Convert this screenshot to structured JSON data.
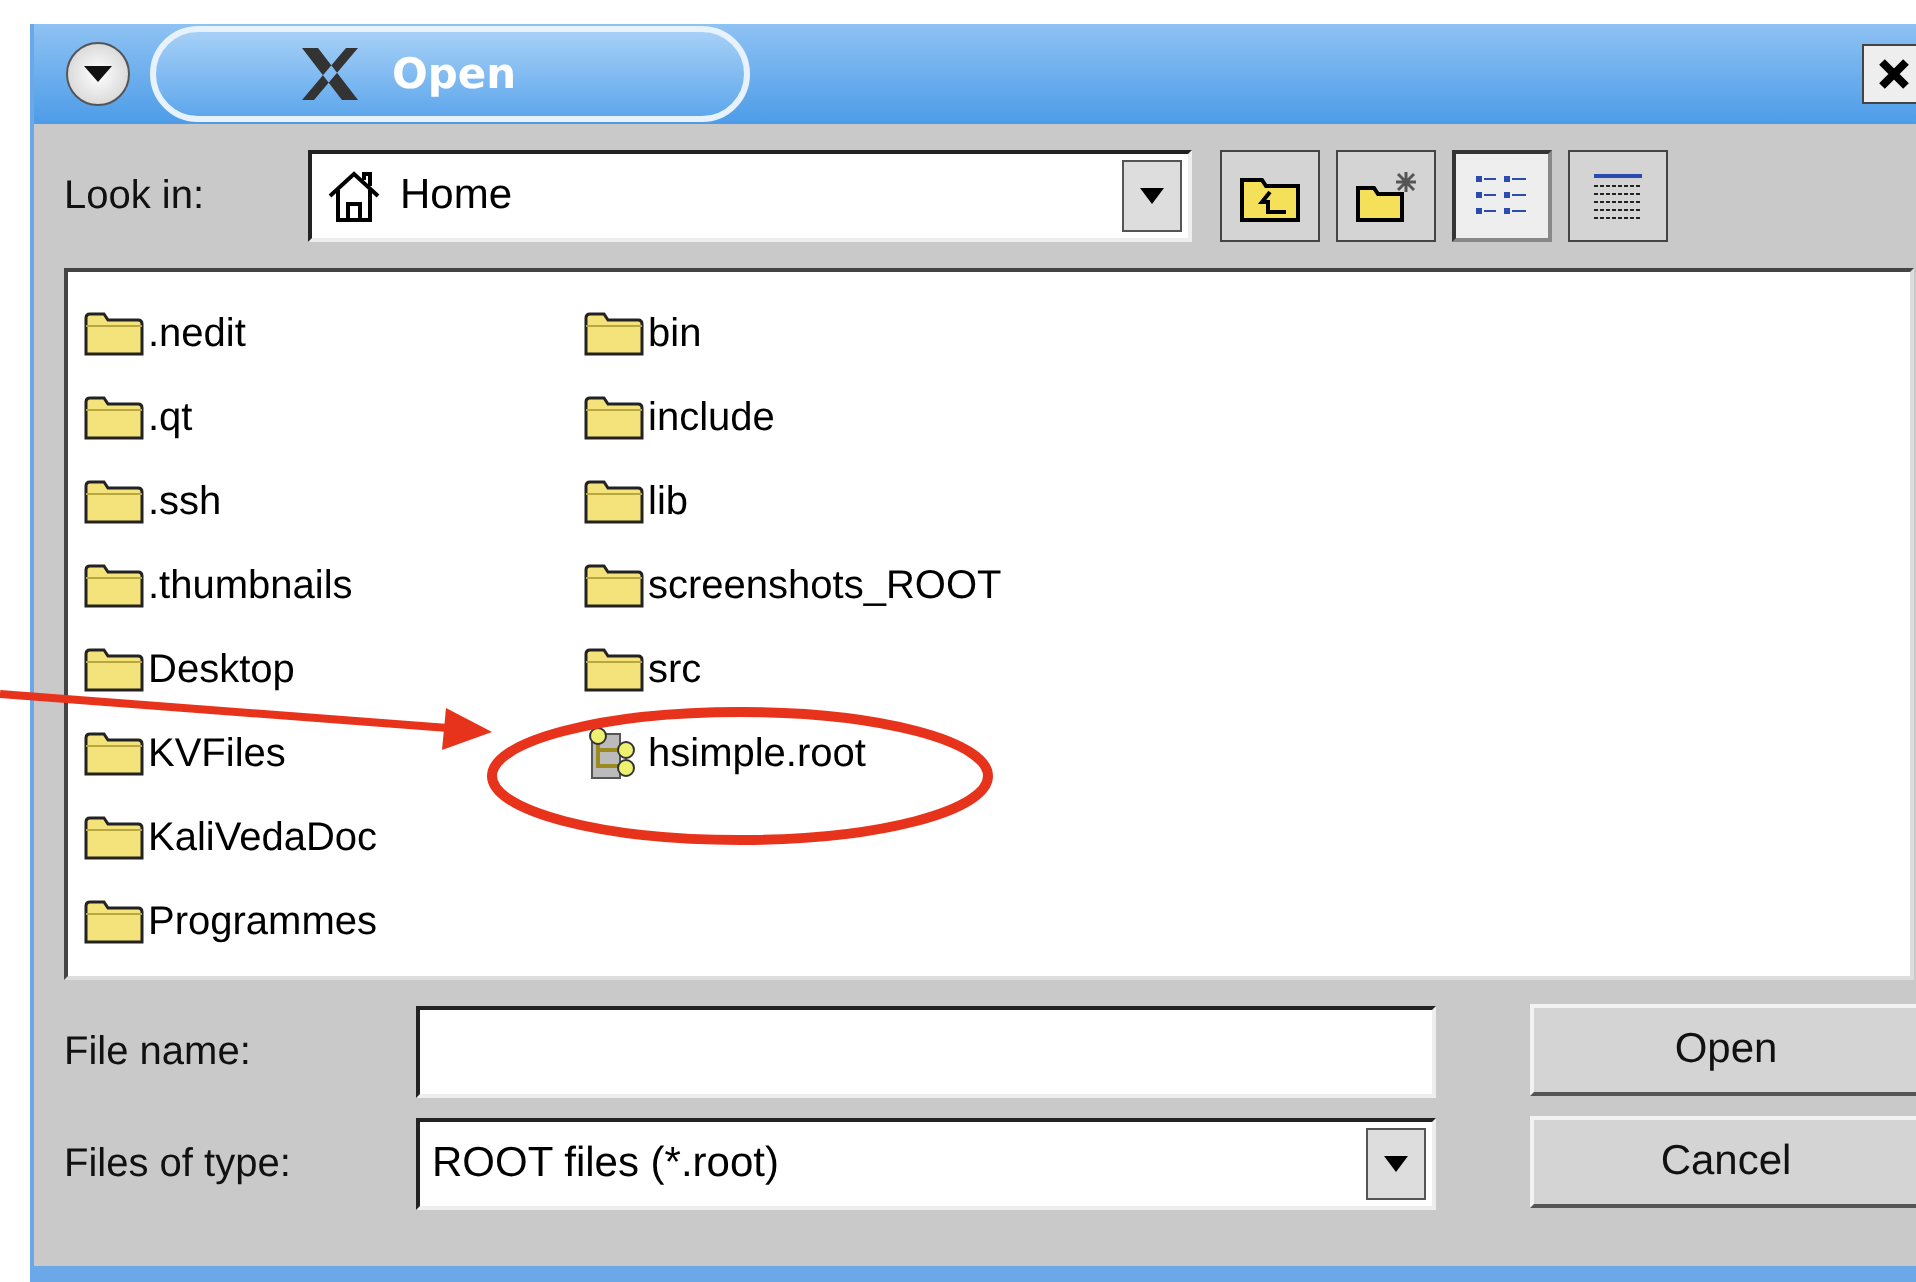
{
  "window": {
    "title": "Open"
  },
  "look_in": {
    "label": "Look in:",
    "value": "Home"
  },
  "view_buttons": [
    {
      "kind": "list",
      "selected": true
    },
    {
      "kind": "details",
      "selected": false
    }
  ],
  "columns": [
    {
      "items": [
        {
          "name": ".nedit",
          "kind": "folder"
        },
        {
          "name": ".qt",
          "kind": "folder"
        },
        {
          "name": ".ssh",
          "kind": "folder"
        },
        {
          "name": ".thumbnails",
          "kind": "folder"
        },
        {
          "name": "Desktop",
          "kind": "folder"
        },
        {
          "name": "KVFiles",
          "kind": "folder"
        },
        {
          "name": "KaliVedaDoc",
          "kind": "folder"
        },
        {
          "name": "Programmes",
          "kind": "folder"
        }
      ]
    },
    {
      "items": [
        {
          "name": "bin",
          "kind": "folder"
        },
        {
          "name": "include",
          "kind": "folder"
        },
        {
          "name": "lib",
          "kind": "folder"
        },
        {
          "name": "screenshots_ROOT",
          "kind": "folder"
        },
        {
          "name": "src",
          "kind": "folder"
        },
        {
          "name": "hsimple.root",
          "kind": "root-file"
        }
      ]
    }
  ],
  "file_name": {
    "label": "File name:"
  },
  "file_type": {
    "label": "Files of type:",
    "value": "ROOT files (*.root)"
  },
  "buttons": [
    "Open",
    "Cancel"
  ]
}
